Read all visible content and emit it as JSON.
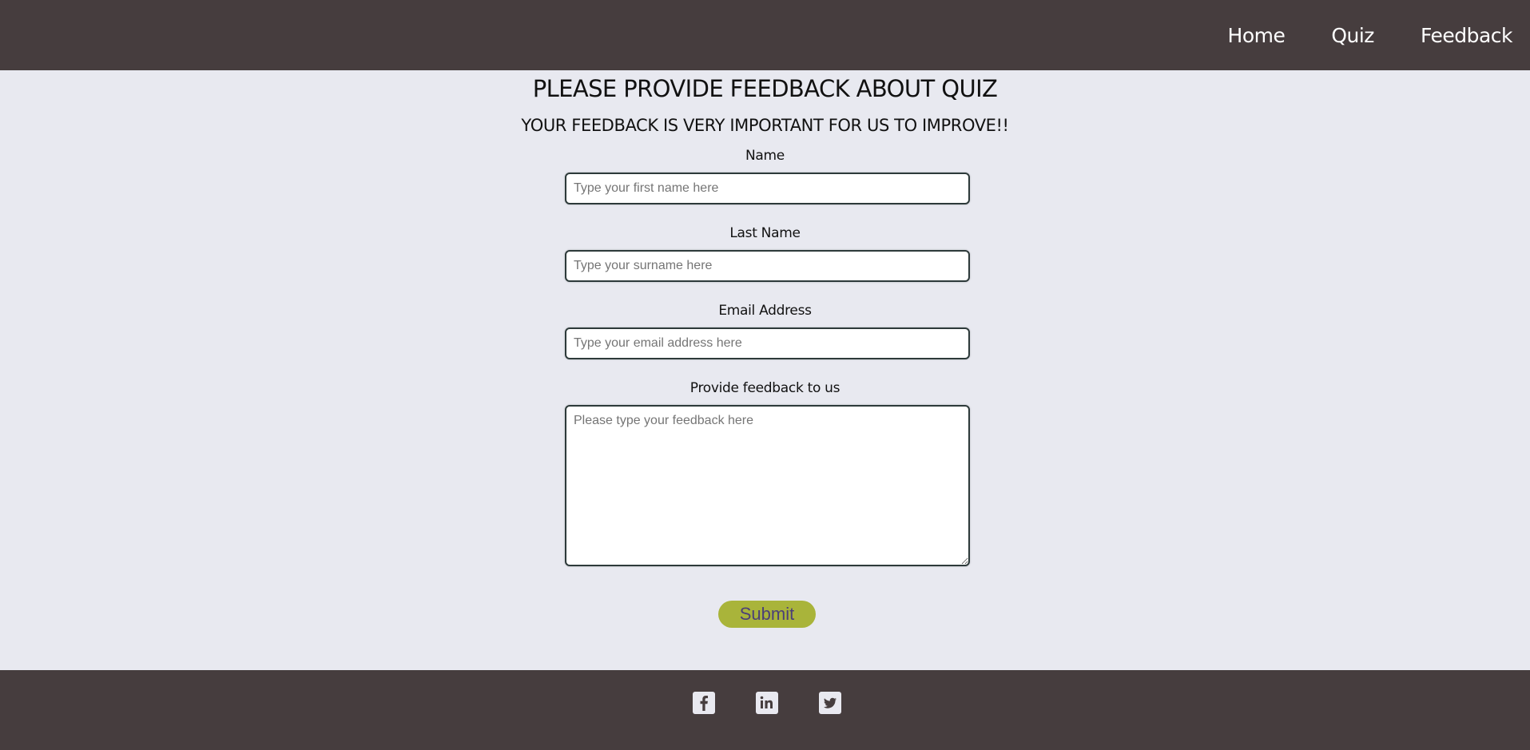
{
  "nav": {
    "items": [
      {
        "label": "Home"
      },
      {
        "label": "Quiz"
      },
      {
        "label": "Feedback"
      }
    ]
  },
  "main": {
    "title": "PLEASE PROVIDE FEEDBACK ABOUT QUIZ",
    "subtitle": "YOUR FEEDBACK IS VERY IMPORTANT FOR US TO IMPROVE!!"
  },
  "form": {
    "name": {
      "label": "Name",
      "placeholder": "Type your first name here",
      "value": ""
    },
    "last_name": {
      "label": "Last Name",
      "placeholder": "Type your surname here",
      "value": ""
    },
    "email": {
      "label": "Email Address",
      "placeholder": "Type your email address here",
      "value": ""
    },
    "feedback": {
      "label": "Provide feedback to us",
      "placeholder": "Please type your feedback here",
      "value": ""
    },
    "submit_label": "Submit"
  },
  "footer": {
    "icons": [
      "facebook-icon",
      "linkedin-icon",
      "twitter-icon"
    ]
  },
  "colors": {
    "header_bg": "#463d3e",
    "page_bg": "#e8e9f0",
    "submit_bg": "#a9b43a",
    "submit_text": "#4b3f78"
  }
}
